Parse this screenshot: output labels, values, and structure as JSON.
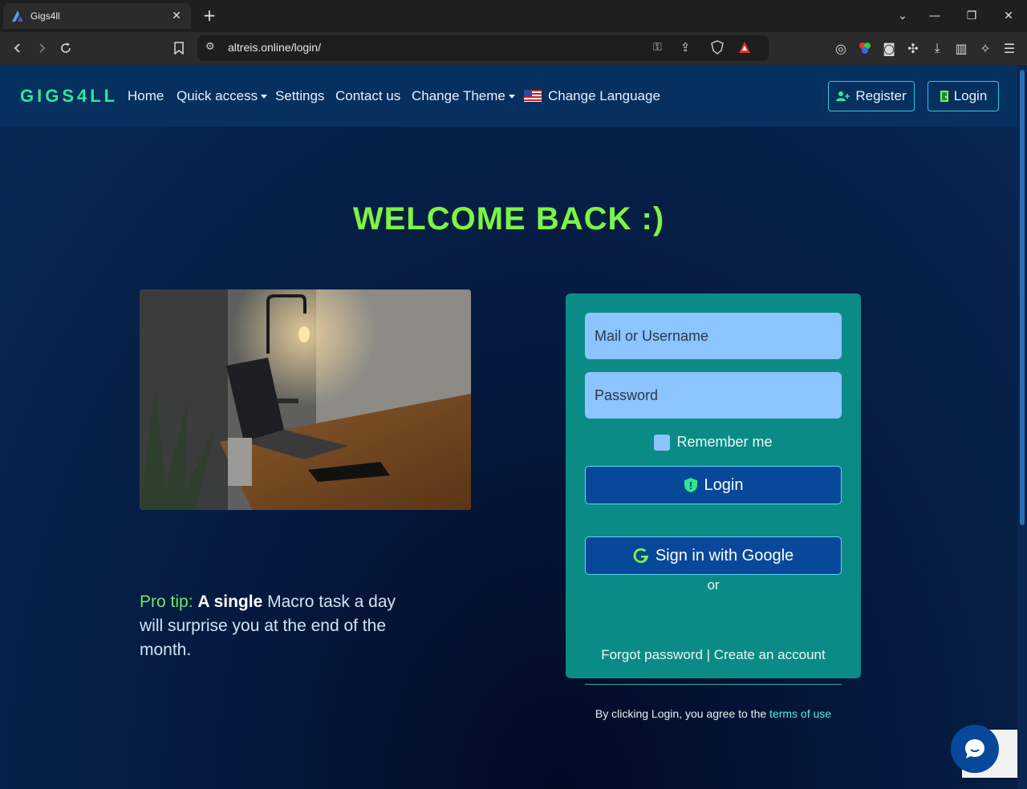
{
  "browser": {
    "tab_title": "Gigs4ll",
    "tab_close": "✕",
    "new_tab": "+",
    "url": "altreis.online/login/",
    "window_controls": {
      "minimize": "—",
      "restore": "❐",
      "close": "✕",
      "tab_search": "⌄"
    }
  },
  "navbar": {
    "brand": "GIGS4LL",
    "links": {
      "home": "Home",
      "quick_access": "Quick access",
      "settings": "Settings",
      "contact": "Contact us",
      "change_theme": "Change Theme",
      "change_language": "Change Language"
    },
    "register": "Register",
    "login": "Login"
  },
  "main": {
    "heading": "WELCOME BACK :)",
    "pro_tip": {
      "label": "Pro tip:",
      "strong": "A single",
      "rest": "Macro task a day will surprise you at the end of the month."
    }
  },
  "login_form": {
    "username_placeholder": "Mail or Username",
    "password_placeholder": "Password",
    "remember_label": "Remember me",
    "login_button": "Login",
    "or_text": "or",
    "google_button": "Sign in with Google",
    "forgot_password": "Forgot password",
    "separator": "|",
    "create_account": "Create an account",
    "terms_prefix": "By clicking Login, you agree to the",
    "terms_link": "terms of use"
  },
  "colors": {
    "brand": "#2ee89a",
    "heading": "#7cf542",
    "card": "#0b8b86",
    "button": "#08489a",
    "input": "#8cc4ff",
    "navbar": "#06305f"
  }
}
